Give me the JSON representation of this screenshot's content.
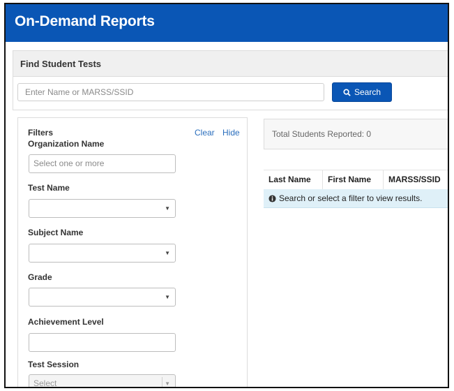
{
  "header": {
    "title": "On-Demand Reports"
  },
  "find": {
    "heading": "Find Student Tests",
    "placeholder": "Enter Name or MARSS/SSID",
    "search_label": "Search"
  },
  "filters": {
    "title": "Filters",
    "clear_label": "Clear",
    "hide_label": "Hide",
    "organization": {
      "label": "Organization Name",
      "placeholder": "Select one or more"
    },
    "test_name": {
      "label": "Test Name",
      "value": ""
    },
    "subject_name": {
      "label": "Subject Name",
      "value": ""
    },
    "grade": {
      "label": "Grade",
      "value": ""
    },
    "achievement": {
      "label": "Achievement Level",
      "value": ""
    },
    "test_session": {
      "label": "Test Session",
      "value": "Select"
    }
  },
  "results": {
    "total_text": "Total Students Reported: 0",
    "columns": [
      "Last Name",
      "First Name",
      "MARSS/SSID"
    ],
    "empty_message": "Search or select a filter to view results."
  },
  "colors": {
    "brand": "#0a56b5",
    "info_bg": "#dff0f8",
    "link": "#2a6ebd"
  },
  "icons": {
    "search": "magnifier-icon",
    "info": "info-circle-icon",
    "caret": "caret-down-icon"
  }
}
